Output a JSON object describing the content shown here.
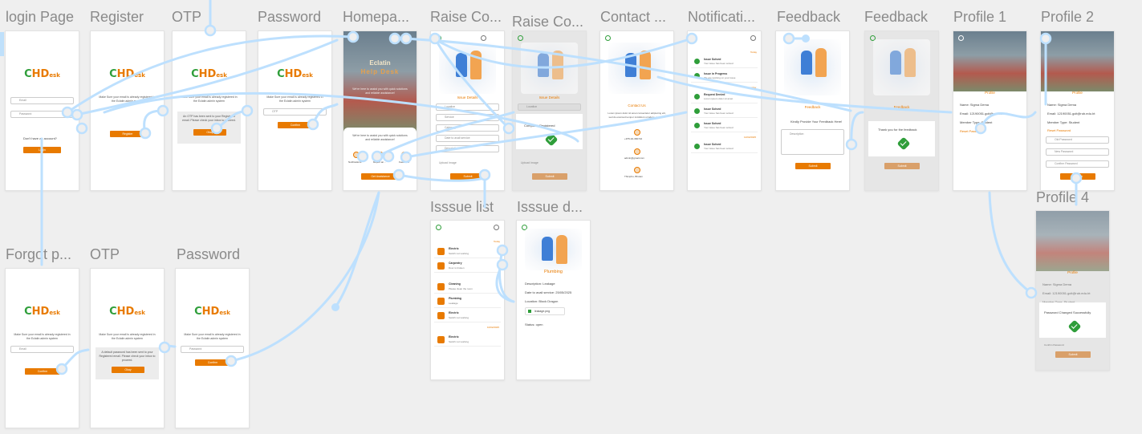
{
  "canvas": {
    "background": "#efefef",
    "wire_color": "#bde0fe",
    "accent": "#e87a00",
    "brand_green": "#2f9e3a"
  },
  "labels": {
    "login": "login Page",
    "register": "Register",
    "otp1": "OTP",
    "password1": "Password",
    "homepage": "Homepa...",
    "raise1": "Raise Co...",
    "raise2": "Raise Co...",
    "contact": "Contact ...",
    "notifications": "Notificati...",
    "feedback1": "Feedback",
    "feedback2": "Feedback",
    "profile1": "Profile 1",
    "profile2": "Profile 2",
    "profile4": "Profile 4",
    "issue_list": "Isssue list",
    "issue_detail": "Isssue d...",
    "forgot": "Forgot p...",
    "otp2": "OTP",
    "password2": "Password"
  },
  "logo": {
    "c": "C",
    "hd": "HD",
    "esk": "esk"
  },
  "login": {
    "email": "Email",
    "password": "Password",
    "no_account": "Don't have an account?",
    "button": "Login"
  },
  "register": {
    "text": "Make Sure your email is already registered in the Eclatin admin system",
    "button": "Register"
  },
  "otp1": {
    "text": "Make Sure your email is already registered in the Eclatin admin system",
    "note": "An OTP has been sent to your Registered email. Please check your inbox to proceed.",
    "button": "Okay"
  },
  "password1": {
    "text": "Make Sure your email is already registered in the Eclatin admin system",
    "field": "OTP",
    "button": "Confirm"
  },
  "homepage": {
    "title1": "Eclatin",
    "title2": "Help Desk",
    "tagline": "We're here to assist you with quick solutions and reliable assistance!",
    "tagline2": "We're here to assist you with quick solutions and reliable assistance!",
    "tiles": [
      "Notifications",
      "Report an...",
      "Feedback"
    ],
    "button": "Get Assistance"
  },
  "raise1": {
    "section": "Issue Details",
    "fields": [
      "Location",
      "Service",
      "Category",
      "Date to avail service",
      "Description"
    ],
    "attach": "Upload Image",
    "button": "Submit"
  },
  "raise2": {
    "section": "Issue Details",
    "fields": [
      "Location"
    ],
    "message": "Complaint Registered",
    "attach": "Upload Image",
    "button": "Submit"
  },
  "contact": {
    "section": "Contact Us",
    "text": "Lorem ipsum dolor sit amet consectetur adipiscing elit, sed do eiusmod tempor incididunt ut labore et dolore",
    "phone": "+975-02-366724",
    "email": "admin@gmail.com",
    "location": "Thimphu, Bhutan"
  },
  "notifications": {
    "groups": [
      {
        "label": "Today",
        "items": [
          {
            "title": "Issue Solved",
            "sub": "Your issue has been solved"
          },
          {
            "title": "Issue in Progress",
            "sub": "We are working on your issue"
          }
        ]
      },
      {
        "label": "Yesterday",
        "items": [
          {
            "title": "Request Denied",
            "sub": "Lorem ipsum dolor sit amet"
          },
          {
            "title": "Issue Solved",
            "sub": "Your issue has been solved"
          },
          {
            "title": "Issue Solved",
            "sub": "Your issue has been solved"
          }
        ]
      },
      {
        "label": "12/02/2025",
        "items": [
          {
            "title": "Issue Solved",
            "sub": "Your issue has been solved"
          }
        ]
      }
    ]
  },
  "feedback1": {
    "section": "Feedback",
    "prompt": "Kindly Provide Your Feedback Here!",
    "placeholder": "Description",
    "button": "Submit"
  },
  "feedback2": {
    "section": "Feedback",
    "message": "Thank you for the feedback",
    "button": "Submit"
  },
  "profile1": {
    "section": "Profile",
    "name": "Name: Sigma Dema",
    "email": "Email: 12190051.gcit@rub.edu.bt",
    "type": "Member Type: Student",
    "reset": "Reset Password"
  },
  "profile2": {
    "section": "Profile",
    "name": "Name: Sigma Dema",
    "email": "Email: 12190051.gcit@rub.edu.bt",
    "type": "Member Type: Student",
    "reset": "Reset Password",
    "fields": [
      "Old Password",
      "New Password",
      "Confirm Password"
    ],
    "button": "Confirm"
  },
  "profile4": {
    "section": "Profile",
    "name": "Name: Sigma Dema",
    "email": "Email: 12190051.gcit@rub.edu.bt",
    "type": "Member Type: Student",
    "message": "Password Changed Successfully",
    "reset": "Confirm Password",
    "button": "Submit"
  },
  "issue_list": {
    "groups": [
      {
        "label": "Today",
        "items": [
          {
            "title": "Electric",
            "sub": "Switch not working"
          },
          {
            "title": "Carpentry",
            "sub": "Door is broken"
          }
        ]
      },
      {
        "label": "",
        "items": [
          {
            "title": "Cleaning",
            "sub": "Please clean the room"
          },
          {
            "title": "Plumbing",
            "sub": "Leakage"
          },
          {
            "title": "Electric",
            "sub": "Switch not working"
          }
        ]
      },
      {
        "label": "10/02/2025",
        "items": [
          {
            "title": "Electric",
            "sub": "Switch not working"
          }
        ]
      }
    ]
  },
  "issue_detail": {
    "section": "Plumbing",
    "description": "Description: Leakage",
    "date": "Date to avail service: 25/05/2025",
    "location": "Location: Block Dragon",
    "file": "leakage.png",
    "status": "Status: open"
  },
  "forgot": {
    "text": "Make Sure your email is already registered in the Eclatin admin system",
    "field": "Email",
    "button": "Confirm"
  },
  "otp2": {
    "text": "Make Sure your email is already registered in the Eclatin admin system",
    "note": "A default password has been sent to your Registered email. Please check your inbox to proceed.",
    "button": "Okay"
  },
  "password2": {
    "text": "Make Sure your email is already registered in the Eclatin admin system",
    "field": "Password",
    "button": "Confirm"
  }
}
